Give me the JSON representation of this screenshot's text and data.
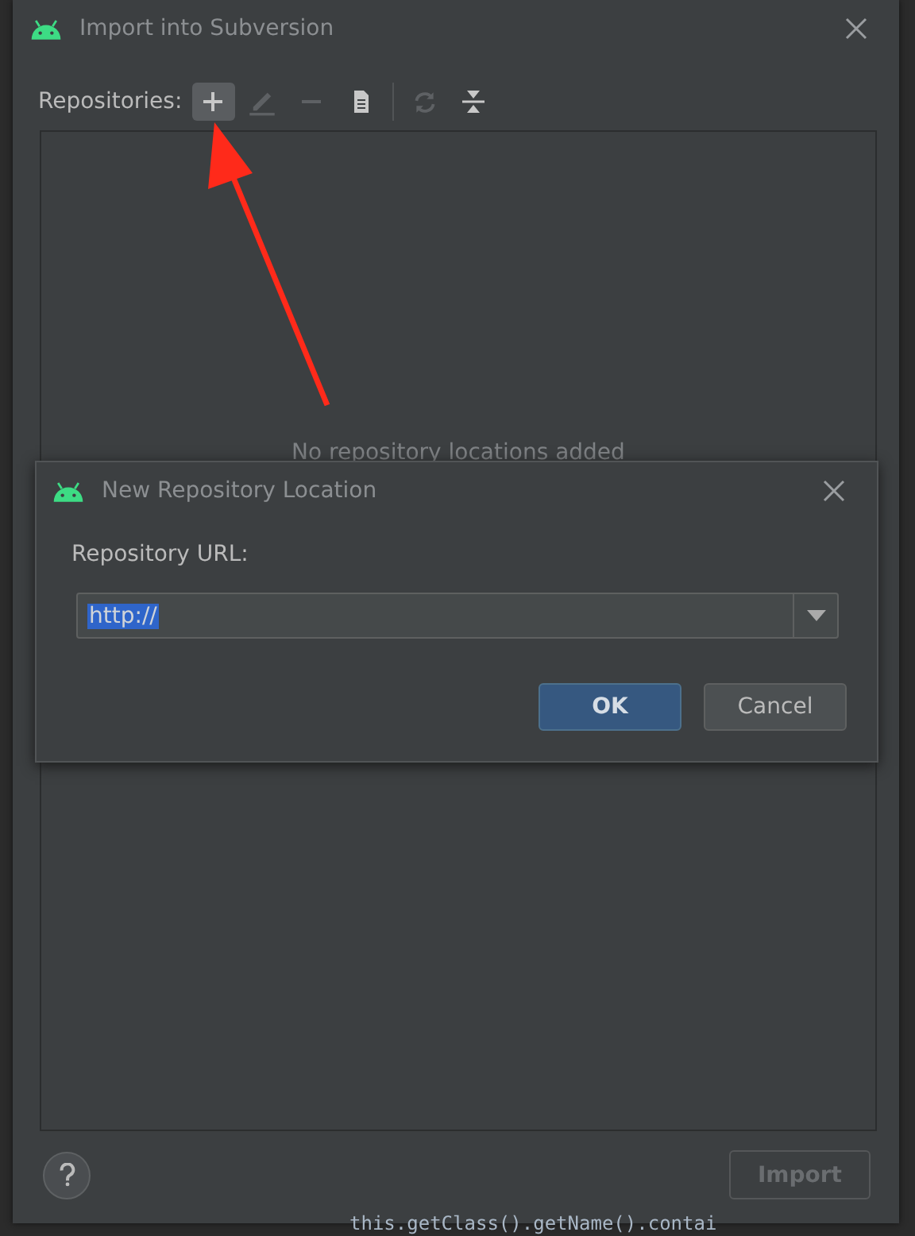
{
  "dialog": {
    "title": "Import into Subversion",
    "toolbar_label": "Repositories:",
    "toolbar_groups": [
      [
        {
          "kind": "add",
          "disabled": false,
          "highlighted": true
        },
        {
          "kind": "edit",
          "disabled": true,
          "highlighted": false
        },
        {
          "kind": "remove",
          "disabled": true,
          "highlighted": false
        },
        {
          "kind": "document",
          "disabled": false,
          "highlighted": false
        }
      ],
      [
        {
          "kind": "refresh",
          "disabled": true,
          "highlighted": false
        },
        {
          "kind": "collapse",
          "disabled": false,
          "highlighted": false
        }
      ]
    ],
    "empty_text": "No repository locations added",
    "import_button": {
      "label": "Import",
      "disabled": true
    }
  },
  "popup": {
    "title": "New Repository Location",
    "label": "Repository URL:",
    "value": "http://",
    "buttons": [
      {
        "label": "OK",
        "kind": "primary"
      },
      {
        "label": "Cancel",
        "kind": "secondary"
      }
    ]
  },
  "editor": {
    "code_line": "this.getClass().getName().contai"
  }
}
